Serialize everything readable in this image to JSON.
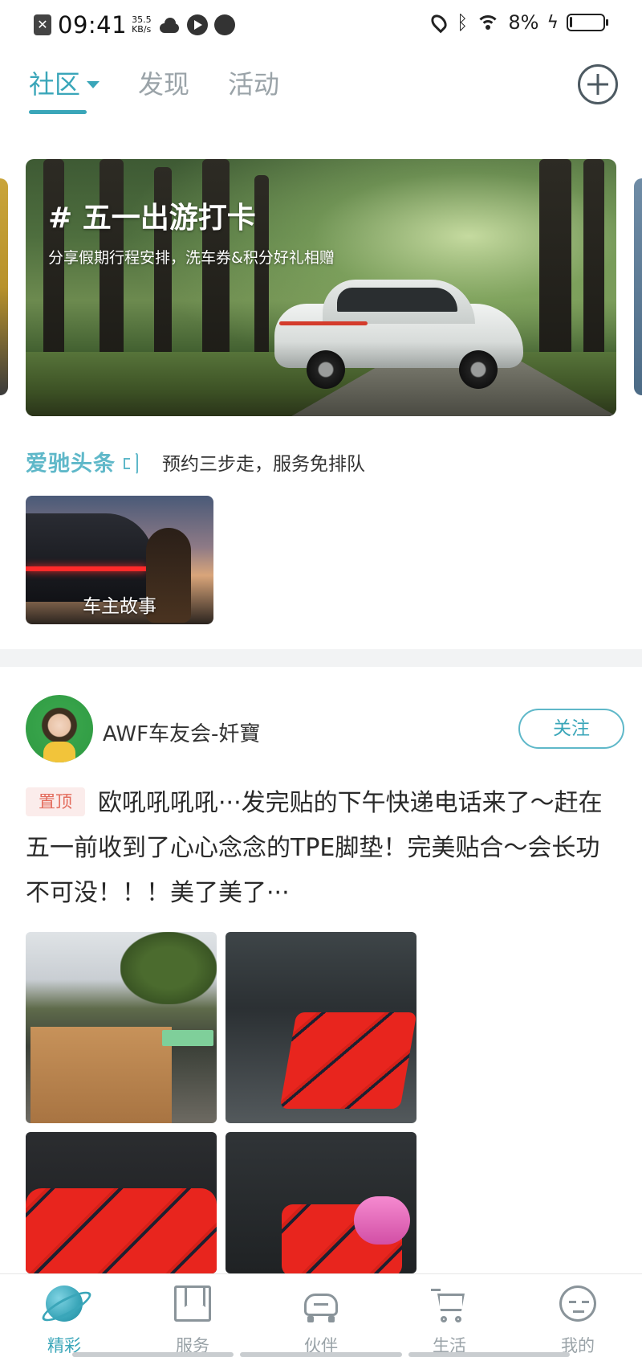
{
  "status_bar": {
    "time": "09:41",
    "net_speed_value": "35.5",
    "net_speed_unit": "KB/s",
    "battery_percent": "8%"
  },
  "top_tabs": [
    {
      "label": "社区",
      "active": true
    },
    {
      "label": "发现",
      "active": false
    },
    {
      "label": "活动",
      "active": false
    }
  ],
  "banner": {
    "title": "# 五一出游打卡",
    "subtitle": "分享假期行程安排，洗车券&积分好礼相赠"
  },
  "ticker": {
    "brand": "爱驰头条",
    "text": "预约三步走，服务免排队"
  },
  "story_card": {
    "label": "车主故事"
  },
  "post": {
    "author": "AWF车友会-奷寶",
    "follow_label": "关注",
    "pin_label": "置顶",
    "text": "欧吼吼吼吼···发完贴的下午快递电话来了～赶在五一前收到了心心念念的TPE脚垫！完美贴合～会长功不可没！！！美了美了···"
  },
  "bottom_nav": [
    {
      "label": "精彩",
      "icon": "planet-icon",
      "active": true
    },
    {
      "label": "服务",
      "icon": "book-icon",
      "active": false
    },
    {
      "label": "伙伴",
      "icon": "car-icon",
      "active": false
    },
    {
      "label": "生活",
      "icon": "cart-icon",
      "active": false
    },
    {
      "label": "我的",
      "icon": "me-icon",
      "active": false
    }
  ],
  "colors": {
    "accent": "#3aa6b9",
    "pin_text": "#e36b5c",
    "pin_bg": "#fbeceb"
  }
}
